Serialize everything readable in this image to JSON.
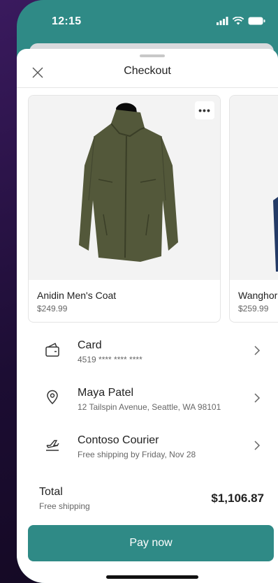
{
  "status_bar": {
    "time": "12:15"
  },
  "header": {
    "title": "Checkout"
  },
  "products": [
    {
      "name": "Anidin Men's Coat",
      "price": "$249.99",
      "more": "•••"
    },
    {
      "name": "Wanghor",
      "price": "$259.99"
    }
  ],
  "payment": {
    "title": "Card",
    "subtitle": "4519 **** **** ****"
  },
  "address": {
    "title": "Maya Patel",
    "subtitle": "12 Tailspin Avenue, Seattle, WA 98101"
  },
  "shipping": {
    "title": "Contoso Courier",
    "subtitle": "Free shipping by Friday, Nov 28"
  },
  "total": {
    "label": "Total",
    "subtitle": "Free shipping",
    "amount": "$1,106.87"
  },
  "pay_button": {
    "label": "Pay now"
  },
  "colors": {
    "accent": "#2f8a86",
    "background": "#1c0d33"
  },
  "icons": [
    "signal-icon",
    "wifi-icon",
    "battery-icon",
    "close-icon",
    "more-icon",
    "wallet-icon",
    "location-pin-icon",
    "shipping-plane-icon",
    "chevron-right-icon"
  ]
}
